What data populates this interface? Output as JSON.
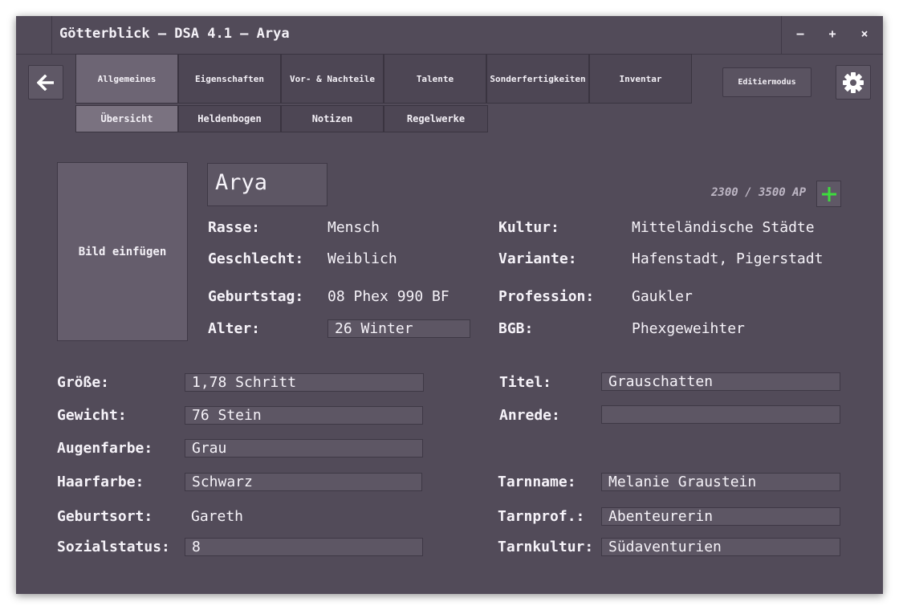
{
  "window": {
    "title": "Götterblick – DSA 4.1 – Arya",
    "minimize": "–",
    "maximize": "+",
    "close": "×"
  },
  "nav": {
    "back_icon": "arrow-left-icon",
    "settings_icon": "gear-icon",
    "edit_mode_label": "Editiermodus",
    "tabs": [
      {
        "label": "Allgemeines",
        "active": true
      },
      {
        "label": "Eigenschaften",
        "active": false
      },
      {
        "label": "Vor- & Nachteile",
        "active": false
      },
      {
        "label": "Talente",
        "active": false
      },
      {
        "label": "Sonderfertigkeiten",
        "active": false
      },
      {
        "label": "Inventar",
        "active": false
      }
    ],
    "subtabs": [
      {
        "label": "Übersicht",
        "active": true
      },
      {
        "label": "Heldenbogen",
        "active": false
      },
      {
        "label": "Notizen",
        "active": false
      },
      {
        "label": "Regelwerke",
        "active": false
      }
    ]
  },
  "hero": {
    "picture_label": "Bild einfügen",
    "name": "Arya",
    "ap": "2300 / 3500 AP",
    "ap_add_icon": "plus-icon",
    "info": {
      "rasse_label": "Rasse:",
      "rasse": "Mensch",
      "geschlecht_label": "Geschlecht:",
      "geschlecht": "Weiblich",
      "geburtstag_label": "Geburtstag:",
      "geburtstag": "08 Phex 990 BF",
      "alter_label": "Alter:",
      "alter": "26 Winter",
      "kultur_label": "Kultur:",
      "kultur": "Mitteländische Städte",
      "variante_label": "Variante:",
      "variante": "Hafenstadt, Pigerstadt",
      "profession_label": "Profession:",
      "profession": "Gaukler",
      "bgb_label": "BGB:",
      "bgb": "Phexgeweihter"
    },
    "details": {
      "groesse_label": "Größe:",
      "groesse": "1,78 Schritt",
      "gewicht_label": "Gewicht:",
      "gewicht": "76 Stein",
      "augenfarbe_label": "Augenfarbe:",
      "augenfarbe": "Grau",
      "haarfarbe_label": "Haarfarbe:",
      "haarfarbe": "Schwarz",
      "geburtsort_label": "Geburtsort:",
      "geburtsort": "Gareth",
      "sozialstatus_label": "Sozialstatus:",
      "sozialstatus": "8",
      "titel_label": "Titel:",
      "titel": "Grauschatten",
      "anrede_label": "Anrede:",
      "anrede": "",
      "tarnname_label": "Tarnname:",
      "tarnname": "Melanie Graustein",
      "tarnprof_label": "Tarnprof.:",
      "tarnprof": "Abenteurerin",
      "tarnkultur_label": "Tarnkultur:",
      "tarnkultur": "Südaventurien"
    }
  },
  "colors": {
    "background": "#524b59",
    "active_tab": "#6d6574",
    "accent_plus": "#3ddc3d"
  }
}
